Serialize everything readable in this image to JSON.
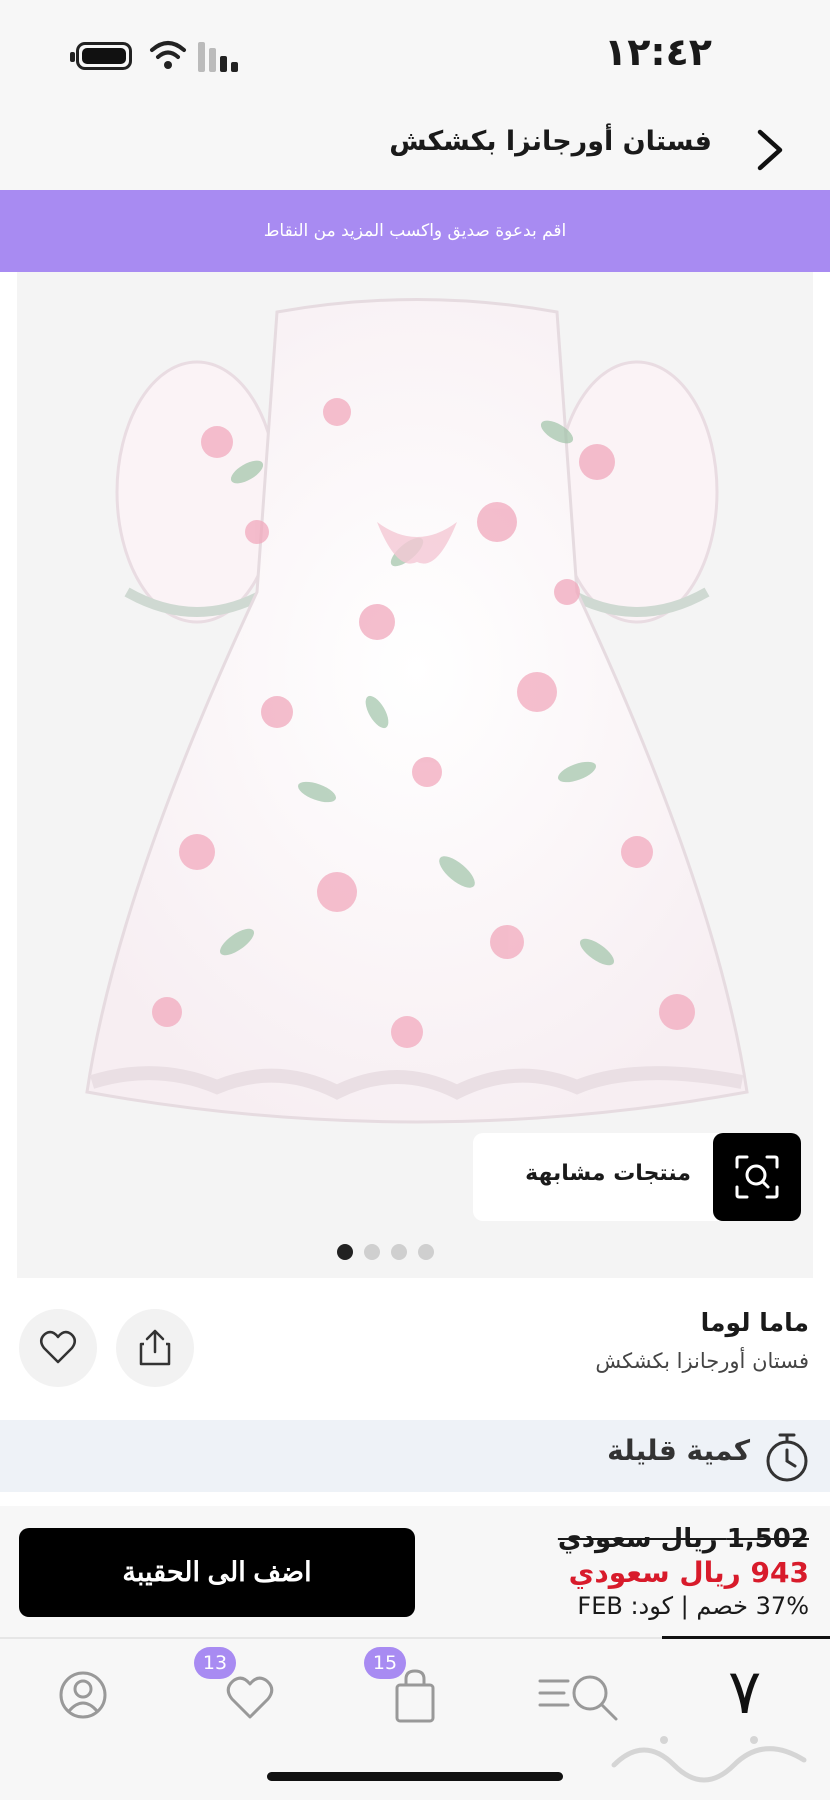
{
  "status_bar": {
    "time": "١٢:٤٢"
  },
  "header": {
    "title": "فستان أورجانزا بكشكش"
  },
  "banner": {
    "text": "اقم بدعوة صديق واكسب المزيد من النقاط"
  },
  "product_image": {
    "similar_label": "منتجات مشابهة",
    "carousel_total": 4,
    "carousel_active": 1
  },
  "product": {
    "brand": "ماما لوما",
    "name": "فستان أورجانزا بكشكش"
  },
  "stock": {
    "label": "كمية قليلة"
  },
  "pricing": {
    "old_price": "1,502 ريال سعودي",
    "new_price": "943 ريال سعودي",
    "discount_line": "37% خصم | كود: FEB",
    "add_to_bag": "اضف الى الحقيبة"
  },
  "tab_bar": {
    "wishlist_count": "13",
    "cart_count": "15",
    "home_logo": "٧"
  },
  "colors": {
    "accent": "#a88bf2",
    "sale_red": "#d81b2b"
  },
  "icons": [
    "battery-icon",
    "wifi-icon",
    "signal-icon",
    "back-arrow-icon",
    "scan-icon",
    "heart-icon",
    "share-icon",
    "clock-icon",
    "profile-icon",
    "search-icon",
    "bag-icon"
  ]
}
